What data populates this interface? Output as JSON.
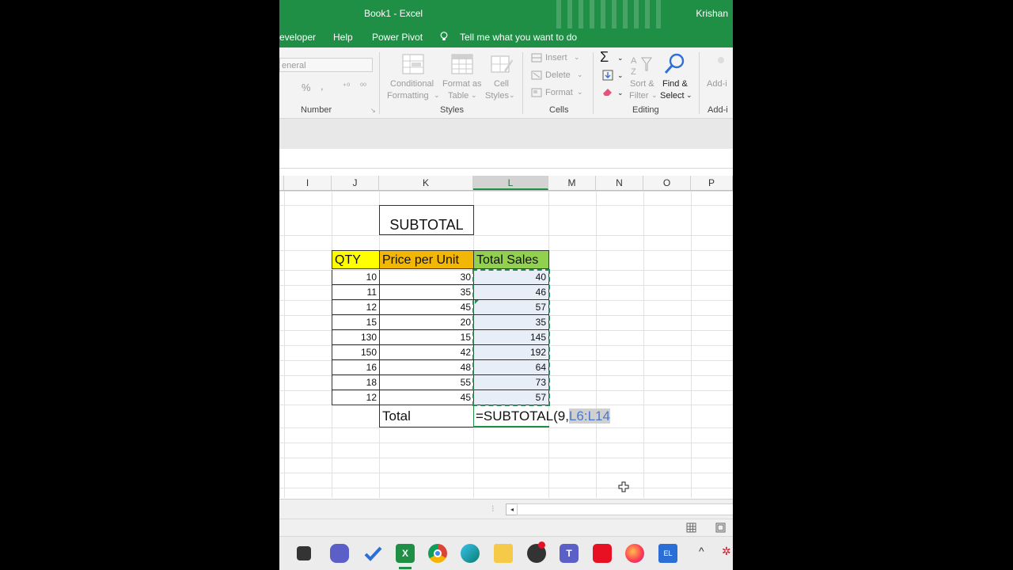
{
  "window": {
    "title": "Book1  -  Excel",
    "user": "Krishan"
  },
  "menu": {
    "tabs": [
      "eveloper",
      "Help",
      "Power Pivot"
    ],
    "tell_me": "Tell me what you want to do"
  },
  "ribbon": {
    "number": {
      "format": "eneral",
      "percent": "%",
      "comma": ",",
      "label": "Number"
    },
    "styles": {
      "conditional_1": "Conditional",
      "conditional_2": "Formatting",
      "table_1": "Format as",
      "table_2": "Table",
      "cell_1": "Cell",
      "cell_2": "Styles",
      "label": "Styles"
    },
    "cells": {
      "insert": "Insert",
      "delete": "Delete",
      "format": "Format",
      "label": "Cells"
    },
    "editing": {
      "sort_1": "Sort &",
      "sort_2": "Filter",
      "find_1": "Find &",
      "find_2": "Select",
      "label": "Editing"
    },
    "addins": {
      "add_1": "Add-i",
      "label": "Add-i"
    }
  },
  "columns": [
    "I",
    "J",
    "K",
    "L",
    "M",
    "N",
    "O",
    "P"
  ],
  "sheet": {
    "title": "SUBTOTAL",
    "headers": {
      "qty": "QTY",
      "price": "Price per Unit",
      "total": "Total Sales"
    },
    "rows": [
      {
        "qty": "10",
        "price": "30",
        "total": "40"
      },
      {
        "qty": "11",
        "price": "35",
        "total": "46"
      },
      {
        "qty": "12",
        "price": "45",
        "total": "57"
      },
      {
        "qty": "15",
        "price": "20",
        "total": "35"
      },
      {
        "qty": "130",
        "price": "15",
        "total": "145"
      },
      {
        "qty": "150",
        "price": "42",
        "total": "192"
      },
      {
        "qty": "16",
        "price": "48",
        "total": "64"
      },
      {
        "qty": "18",
        "price": "55",
        "total": "73"
      },
      {
        "qty": "12",
        "price": "45",
        "total": "57"
      }
    ],
    "total_label": "Total",
    "formula_prefix": "=SUBTOTAL(9,",
    "formula_range": "L6:L14"
  },
  "colors": {
    "excel_green": "#1f8f45",
    "qty_header": "#ffff00",
    "price_header": "#f2b705",
    "total_header": "#92d050",
    "selection": "#e8eef8",
    "range_ref": "#4a78c8"
  }
}
